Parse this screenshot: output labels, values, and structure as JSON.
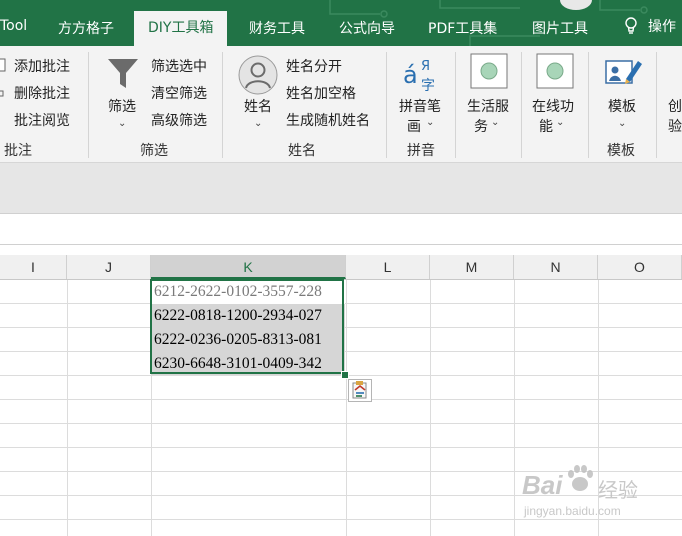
{
  "tabs": {
    "tool": "Tool",
    "fangfang": "方方格子",
    "diy": "DIY工具箱",
    "finance": "财务工具",
    "formula": "公式向导",
    "pdf": "PDF工具集",
    "image": "图片工具",
    "ops": "操作"
  },
  "ribbon": {
    "comments": {
      "add": "添加批注",
      "delete": "删除批注",
      "review": "批注阅览",
      "group": "批注"
    },
    "filter": {
      "main": "筛选",
      "filter_selected": "筛选选中",
      "clear_filter": "清空筛选",
      "advanced": "高级筛选",
      "group": "筛选"
    },
    "name": {
      "main": "姓名",
      "split": "姓名分开",
      "add_space": "姓名加空格",
      "random": "生成随机姓名",
      "group": "姓名"
    },
    "pinyin": {
      "main_line1": "拼音笔",
      "main_line2": "画",
      "group": "拼音"
    },
    "life": {
      "line1": "生活服",
      "line2": "务"
    },
    "online": {
      "line1": "在线功",
      "line2": "能"
    },
    "template": {
      "main": "模板",
      "group": "模板"
    },
    "create": {
      "line1": "创",
      "line2": "验"
    }
  },
  "grid": {
    "columns": [
      "I",
      "J",
      "K",
      "L",
      "M",
      "N",
      "O"
    ],
    "selected_column": "K",
    "cells": [
      "6212-2622-0102-3557-228",
      "6222-0818-1200-2934-027",
      "6222-0236-0205-8313-081",
      "6230-6648-3101-0409-342"
    ]
  },
  "colors": {
    "accent": "#217346",
    "selection_fill": "#d6d6d6",
    "first_cell_text": "#7a7a7a"
  },
  "watermark": {
    "brand": "Bai",
    "brand2": "经验",
    "url": "jingyan.baidu.com"
  }
}
